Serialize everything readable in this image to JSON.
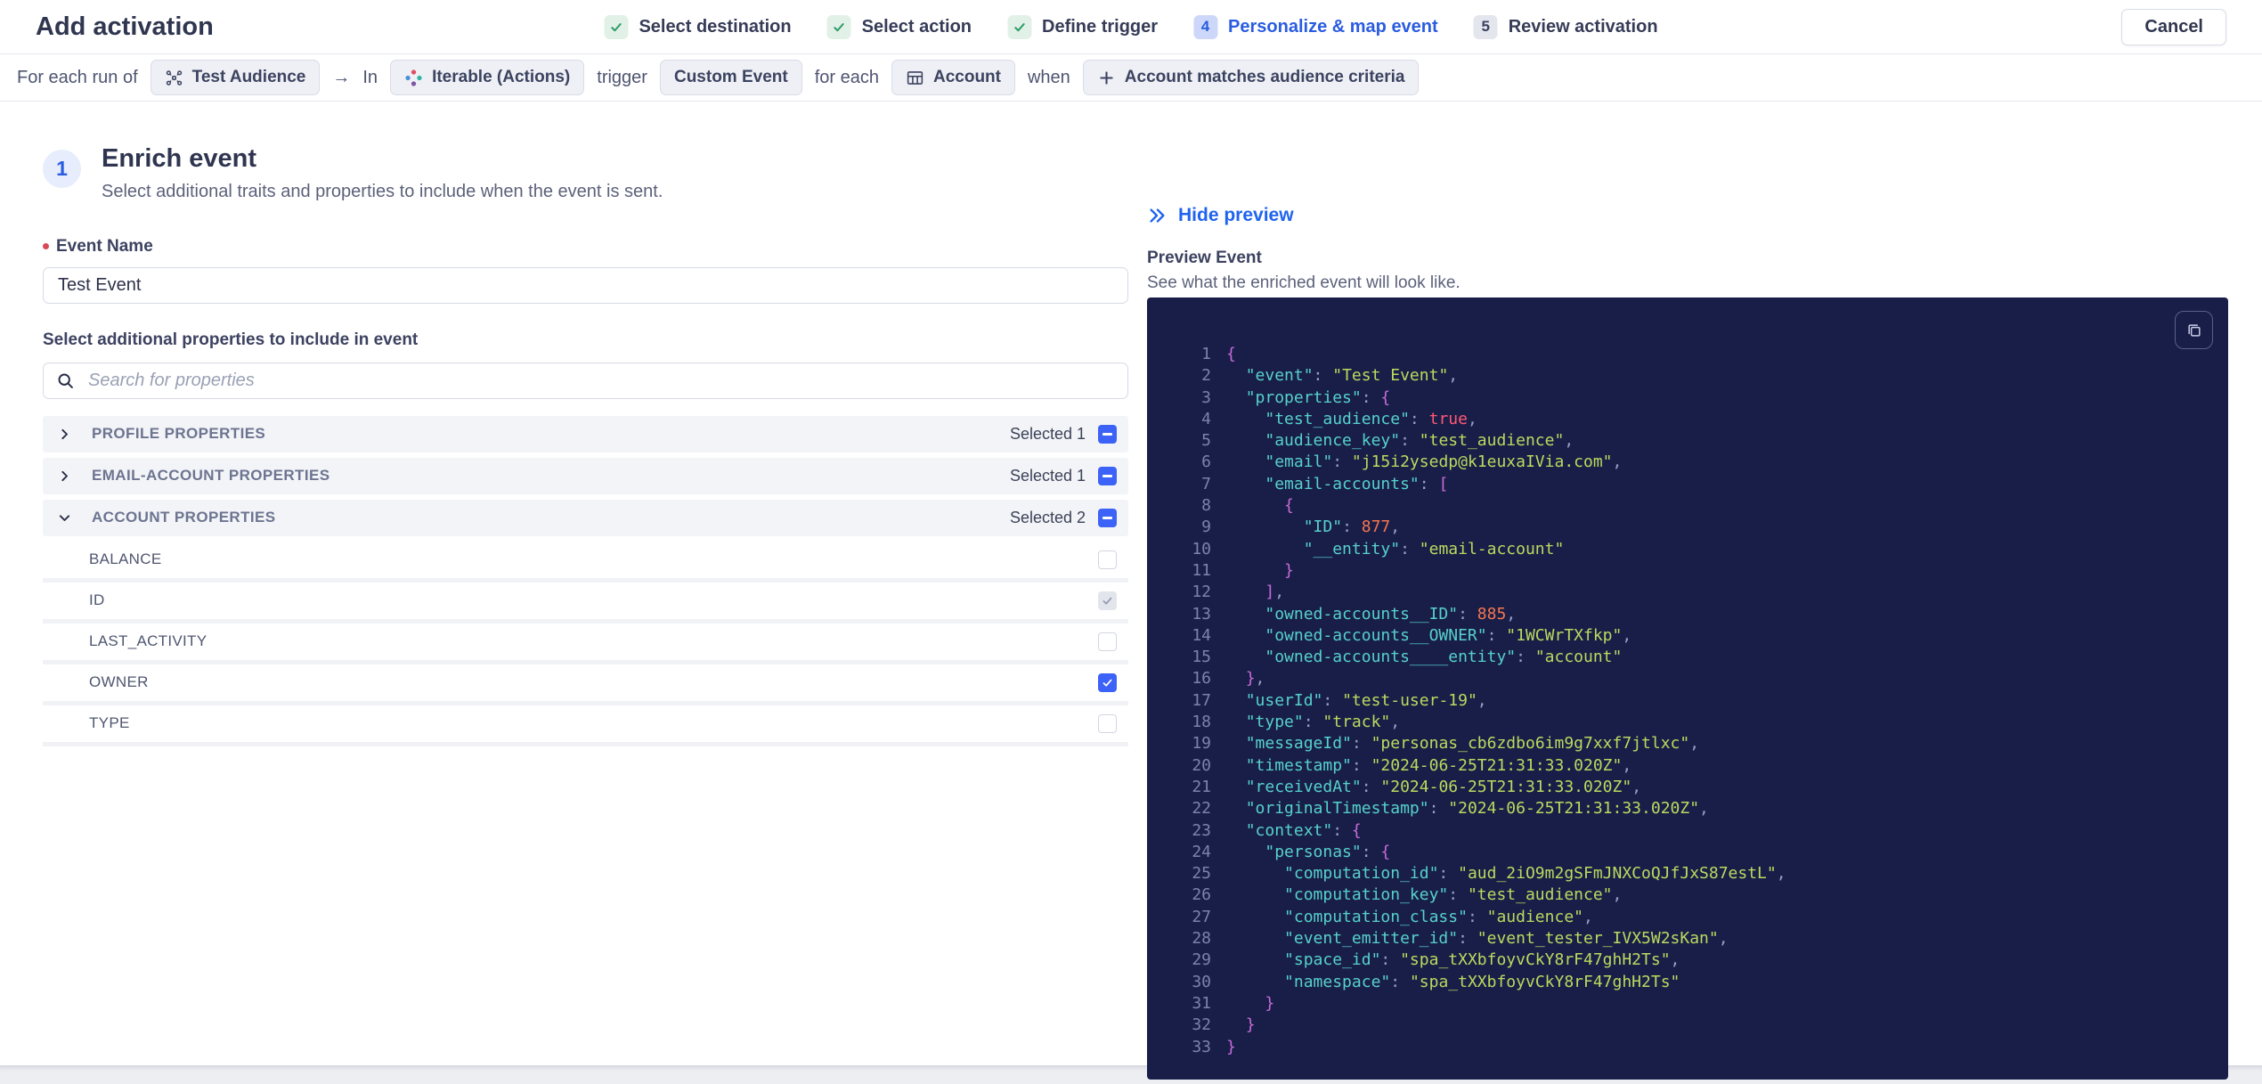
{
  "header": {
    "title": "Add activation",
    "cancel_label": "Cancel"
  },
  "stepper": {
    "steps": [
      {
        "label": "Select destination",
        "state": "done"
      },
      {
        "label": "Select action",
        "state": "done"
      },
      {
        "label": "Define trigger",
        "state": "done"
      },
      {
        "label": "Personalize & map event",
        "state": "active",
        "number": "4"
      },
      {
        "label": "Review activation",
        "state": "upcoming",
        "number": "5"
      }
    ]
  },
  "context_bar": {
    "tokens": [
      {
        "type": "text",
        "text": "For each run of"
      },
      {
        "type": "chip",
        "icon": "audience-icon",
        "label": "Test Audience"
      },
      {
        "type": "text",
        "text": "→"
      },
      {
        "type": "text",
        "text": "In"
      },
      {
        "type": "chip",
        "icon": "iterable-icon",
        "label": "Iterable (Actions)"
      },
      {
        "type": "text",
        "text": "trigger"
      },
      {
        "type": "chip",
        "label": "Custom Event"
      },
      {
        "type": "text",
        "text": "for each"
      },
      {
        "type": "chip",
        "icon": "table-icon",
        "label": "Account"
      },
      {
        "type": "text",
        "text": "when"
      },
      {
        "type": "chip",
        "icon": "plus-icon",
        "label": "Account matches audience criteria"
      }
    ]
  },
  "enrich": {
    "step_number": "1",
    "title": "Enrich event",
    "subtitle": "Select additional traits and properties to include when the event is sent.",
    "event_name_label": "Event Name",
    "event_name_value": "Test Event",
    "properties_label": "Select additional properties to include in event",
    "search_placeholder": "Search for properties"
  },
  "property_groups": [
    {
      "label": "PROFILE PROPERTIES",
      "selected_label": "Selected 1",
      "expanded": false,
      "items": []
    },
    {
      "label": "EMAIL-ACCOUNT PROPERTIES",
      "selected_label": "Selected 1",
      "expanded": false,
      "items": []
    },
    {
      "label": "ACCOUNT PROPERTIES",
      "selected_label": "Selected 2",
      "expanded": true,
      "items": [
        {
          "label": "BALANCE",
          "state": "unchecked"
        },
        {
          "label": "ID",
          "state": "checked-disabled"
        },
        {
          "label": "LAST_ACTIVITY",
          "state": "unchecked"
        },
        {
          "label": "OWNER",
          "state": "checked"
        },
        {
          "label": "TYPE",
          "state": "unchecked"
        }
      ]
    }
  ],
  "preview": {
    "toggle_label": "Hide preview",
    "title": "Preview Event",
    "subtitle": "See what the enriched event will look like.",
    "colors": {
      "accent_blue": "#2a5ce0",
      "checkbox_blue": "#3c62f7",
      "link_blue": "#1f63ef",
      "step_done_green": "#2f9d66",
      "code_background": "#191e48",
      "code_key": "#56d1cc",
      "code_string": "#bada5f",
      "code_number": "#f5764f",
      "code_boolean": "#ff5874",
      "code_punctuation": "#c76bd9",
      "code_line_number": "#7b83ab"
    },
    "code_lines": [
      [
        [
          "p",
          "{"
        ]
      ],
      [
        [
          "w",
          "  "
        ],
        [
          "k",
          "\"event\""
        ],
        [
          "d",
          ": "
        ],
        [
          "s",
          "\"Test Event\""
        ],
        [
          "d",
          ","
        ]
      ],
      [
        [
          "w",
          "  "
        ],
        [
          "k",
          "\"properties\""
        ],
        [
          "d",
          ": "
        ],
        [
          "p",
          "{"
        ]
      ],
      [
        [
          "w",
          "    "
        ],
        [
          "k",
          "\"test_audience\""
        ],
        [
          "d",
          ": "
        ],
        [
          "b",
          "true"
        ],
        [
          "d",
          ","
        ]
      ],
      [
        [
          "w",
          "    "
        ],
        [
          "k",
          "\"audience_key\""
        ],
        [
          "d",
          ": "
        ],
        [
          "s",
          "\"test_audience\""
        ],
        [
          "d",
          ","
        ]
      ],
      [
        [
          "w",
          "    "
        ],
        [
          "k",
          "\"email\""
        ],
        [
          "d",
          ": "
        ],
        [
          "s",
          "\"j15i2ysedp@k1euxaIVia.com\""
        ],
        [
          "d",
          ","
        ]
      ],
      [
        [
          "w",
          "    "
        ],
        [
          "k",
          "\"email-accounts\""
        ],
        [
          "d",
          ": "
        ],
        [
          "p",
          "["
        ]
      ],
      [
        [
          "w",
          "      "
        ],
        [
          "p",
          "{"
        ]
      ],
      [
        [
          "w",
          "        "
        ],
        [
          "k",
          "\"ID\""
        ],
        [
          "d",
          ": "
        ],
        [
          "n",
          "877"
        ],
        [
          "d",
          ","
        ]
      ],
      [
        [
          "w",
          "        "
        ],
        [
          "k",
          "\"__entity\""
        ],
        [
          "d",
          ": "
        ],
        [
          "s",
          "\"email-account\""
        ]
      ],
      [
        [
          "w",
          "      "
        ],
        [
          "p",
          "}"
        ]
      ],
      [
        [
          "w",
          "    "
        ],
        [
          "p",
          "]"
        ],
        [
          "d",
          ","
        ]
      ],
      [
        [
          "w",
          "    "
        ],
        [
          "k",
          "\"owned-accounts__ID\""
        ],
        [
          "d",
          ": "
        ],
        [
          "n",
          "885"
        ],
        [
          "d",
          ","
        ]
      ],
      [
        [
          "w",
          "    "
        ],
        [
          "k",
          "\"owned-accounts__OWNER\""
        ],
        [
          "d",
          ": "
        ],
        [
          "s",
          "\"1WCWrTXfkp\""
        ],
        [
          "d",
          ","
        ]
      ],
      [
        [
          "w",
          "    "
        ],
        [
          "k",
          "\"owned-accounts____entity\""
        ],
        [
          "d",
          ": "
        ],
        [
          "s",
          "\"account\""
        ]
      ],
      [
        [
          "w",
          "  "
        ],
        [
          "p",
          "}"
        ],
        [
          "d",
          ","
        ]
      ],
      [
        [
          "w",
          "  "
        ],
        [
          "k",
          "\"userId\""
        ],
        [
          "d",
          ": "
        ],
        [
          "s",
          "\"test-user-19\""
        ],
        [
          "d",
          ","
        ]
      ],
      [
        [
          "w",
          "  "
        ],
        [
          "k",
          "\"type\""
        ],
        [
          "d",
          ": "
        ],
        [
          "s",
          "\"track\""
        ],
        [
          "d",
          ","
        ]
      ],
      [
        [
          "w",
          "  "
        ],
        [
          "k",
          "\"messageId\""
        ],
        [
          "d",
          ": "
        ],
        [
          "s",
          "\"personas_cb6zdbo6im9g7xxf7jtlxc\""
        ],
        [
          "d",
          ","
        ]
      ],
      [
        [
          "w",
          "  "
        ],
        [
          "k",
          "\"timestamp\""
        ],
        [
          "d",
          ": "
        ],
        [
          "s",
          "\"2024-06-25T21:31:33.020Z\""
        ],
        [
          "d",
          ","
        ]
      ],
      [
        [
          "w",
          "  "
        ],
        [
          "k",
          "\"receivedAt\""
        ],
        [
          "d",
          ": "
        ],
        [
          "s",
          "\"2024-06-25T21:31:33.020Z\""
        ],
        [
          "d",
          ","
        ]
      ],
      [
        [
          "w",
          "  "
        ],
        [
          "k",
          "\"originalTimestamp\""
        ],
        [
          "d",
          ": "
        ],
        [
          "s",
          "\"2024-06-25T21:31:33.020Z\""
        ],
        [
          "d",
          ","
        ]
      ],
      [
        [
          "w",
          "  "
        ],
        [
          "k",
          "\"context\""
        ],
        [
          "d",
          ": "
        ],
        [
          "p",
          "{"
        ]
      ],
      [
        [
          "w",
          "    "
        ],
        [
          "k",
          "\"personas\""
        ],
        [
          "d",
          ": "
        ],
        [
          "p",
          "{"
        ]
      ],
      [
        [
          "w",
          "      "
        ],
        [
          "k",
          "\"computation_id\""
        ],
        [
          "d",
          ": "
        ],
        [
          "s",
          "\"aud_2iO9m2gSFmJNXCoQJfJxS87estL\""
        ],
        [
          "d",
          ","
        ]
      ],
      [
        [
          "w",
          "      "
        ],
        [
          "k",
          "\"computation_key\""
        ],
        [
          "d",
          ": "
        ],
        [
          "s",
          "\"test_audience\""
        ],
        [
          "d",
          ","
        ]
      ],
      [
        [
          "w",
          "      "
        ],
        [
          "k",
          "\"computation_class\""
        ],
        [
          "d",
          ": "
        ],
        [
          "s",
          "\"audience\""
        ],
        [
          "d",
          ","
        ]
      ],
      [
        [
          "w",
          "      "
        ],
        [
          "k",
          "\"event_emitter_id\""
        ],
        [
          "d",
          ": "
        ],
        [
          "s",
          "\"event_tester_IVX5W2sKan\""
        ],
        [
          "d",
          ","
        ]
      ],
      [
        [
          "w",
          "      "
        ],
        [
          "k",
          "\"space_id\""
        ],
        [
          "d",
          ": "
        ],
        [
          "s",
          "\"spa_tXXbfoyvCkY8rF47ghH2Ts\""
        ],
        [
          "d",
          ","
        ]
      ],
      [
        [
          "w",
          "      "
        ],
        [
          "k",
          "\"namespace\""
        ],
        [
          "d",
          ": "
        ],
        [
          "s",
          "\"spa_tXXbfoyvCkY8rF47ghH2Ts\""
        ]
      ],
      [
        [
          "w",
          "    "
        ],
        [
          "p",
          "}"
        ]
      ],
      [
        [
          "w",
          "  "
        ],
        [
          "p",
          "}"
        ]
      ],
      [
        [
          "p",
          "}"
        ]
      ]
    ]
  }
}
